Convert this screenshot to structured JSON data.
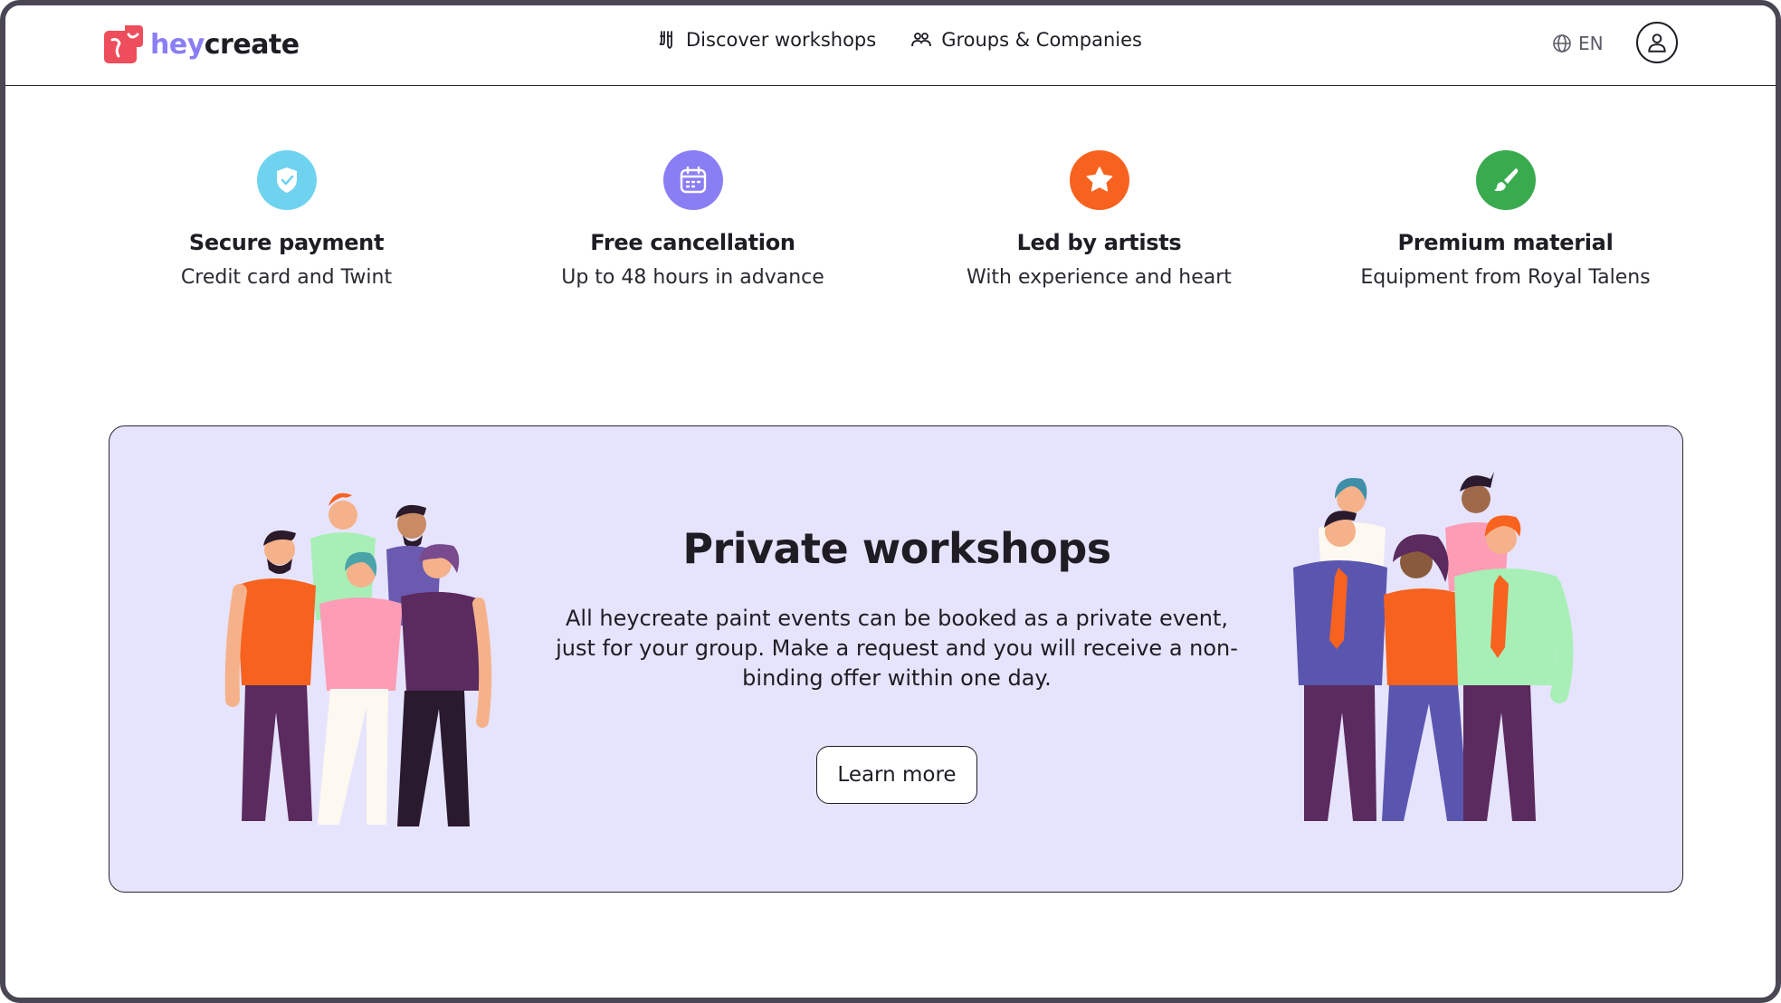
{
  "header": {
    "brand_hey": "hey",
    "brand_create": "create",
    "nav": [
      {
        "label": "Discover workshops",
        "icon": "paintbrush-icon"
      },
      {
        "label": "Groups & Companies",
        "icon": "group-icon"
      }
    ],
    "language": "EN",
    "account_icon": "user-icon"
  },
  "features": [
    {
      "title": "Secure payment",
      "subtitle": "Credit card and Twint",
      "icon": "shield-check-icon",
      "color": "#6fd3ef"
    },
    {
      "title": "Free cancellation",
      "subtitle": "Up to 48 hours in advance",
      "icon": "calendar-icon",
      "color": "#8a7ef5"
    },
    {
      "title": "Led by artists",
      "subtitle": "With experience and heart",
      "icon": "star-icon",
      "color": "#f7631f"
    },
    {
      "title": "Premium material",
      "subtitle": "Equipment from Royal Talens",
      "icon": "paintbrush-icon",
      "color": "#3aaa4f"
    }
  ],
  "banner": {
    "title": "Private workshops",
    "text": "All heycreate paint events can be booked as a private event, just for your group. Make a request and you will receive a non-binding offer within one day.",
    "button_label": "Learn more",
    "background": "#e6e4fd"
  },
  "colors": {
    "brand_red": "#ee4d5b",
    "brand_purple": "#8a7ef5",
    "text_dark": "#1f1c24"
  }
}
